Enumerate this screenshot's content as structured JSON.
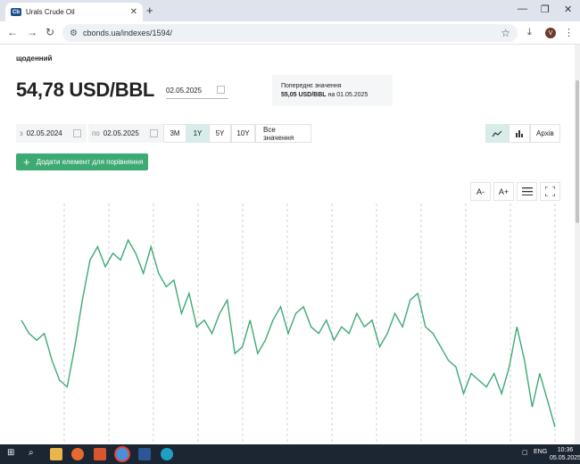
{
  "browser": {
    "tab_title": "Urals Crude Oil",
    "tab_favicon": "Cb",
    "url": "cbonds.ua/indexes/1594/",
    "profile_initial": "V"
  },
  "page": {
    "frequency_label": "щоденний",
    "current_value": "54,78 USD/BBL",
    "current_date": "02.05.2025",
    "previous_label": "Попереднє значення",
    "previous_value": "55,05 USD/BBL",
    "previous_on": "на 01.05.2025",
    "range_from_label": "з",
    "range_from": "02.05.2024",
    "range_to_label": "по",
    "range_to": "02.05.2025",
    "periods": [
      "3M",
      "1Y",
      "5Y",
      "10Y",
      "Все значення"
    ],
    "active_period": "1Y",
    "archive_label": "Архів",
    "add_compare_label": "Додати елемент для порівняння",
    "font_smaller": "A-",
    "font_larger": "A+",
    "line_color": "#3daa74",
    "accent_color": "#d8ecea"
  },
  "chart_data": {
    "type": "line",
    "series": [
      {
        "values": [
          72,
          70,
          69,
          70,
          66,
          63,
          62,
          68,
          75,
          81,
          83,
          80,
          82,
          81,
          84,
          82,
          79,
          83,
          79,
          77,
          78,
          73,
          76,
          71,
          72,
          70,
          73,
          75,
          67,
          68,
          72,
          67,
          69,
          72,
          74,
          70,
          73,
          74,
          71,
          70,
          72,
          69,
          71,
          70,
          73,
          71,
          72,
          68,
          70,
          73,
          71,
          75,
          76,
          71,
          70,
          68,
          66,
          65,
          61,
          64,
          63,
          62,
          64,
          61,
          65,
          71,
          66,
          59,
          64,
          60,
          56
        ]
      }
    ],
    "grid": "vertical-dashed"
  },
  "taskbar": {
    "lang": "ENG",
    "time": "10:36",
    "date": "05.05.2025"
  }
}
